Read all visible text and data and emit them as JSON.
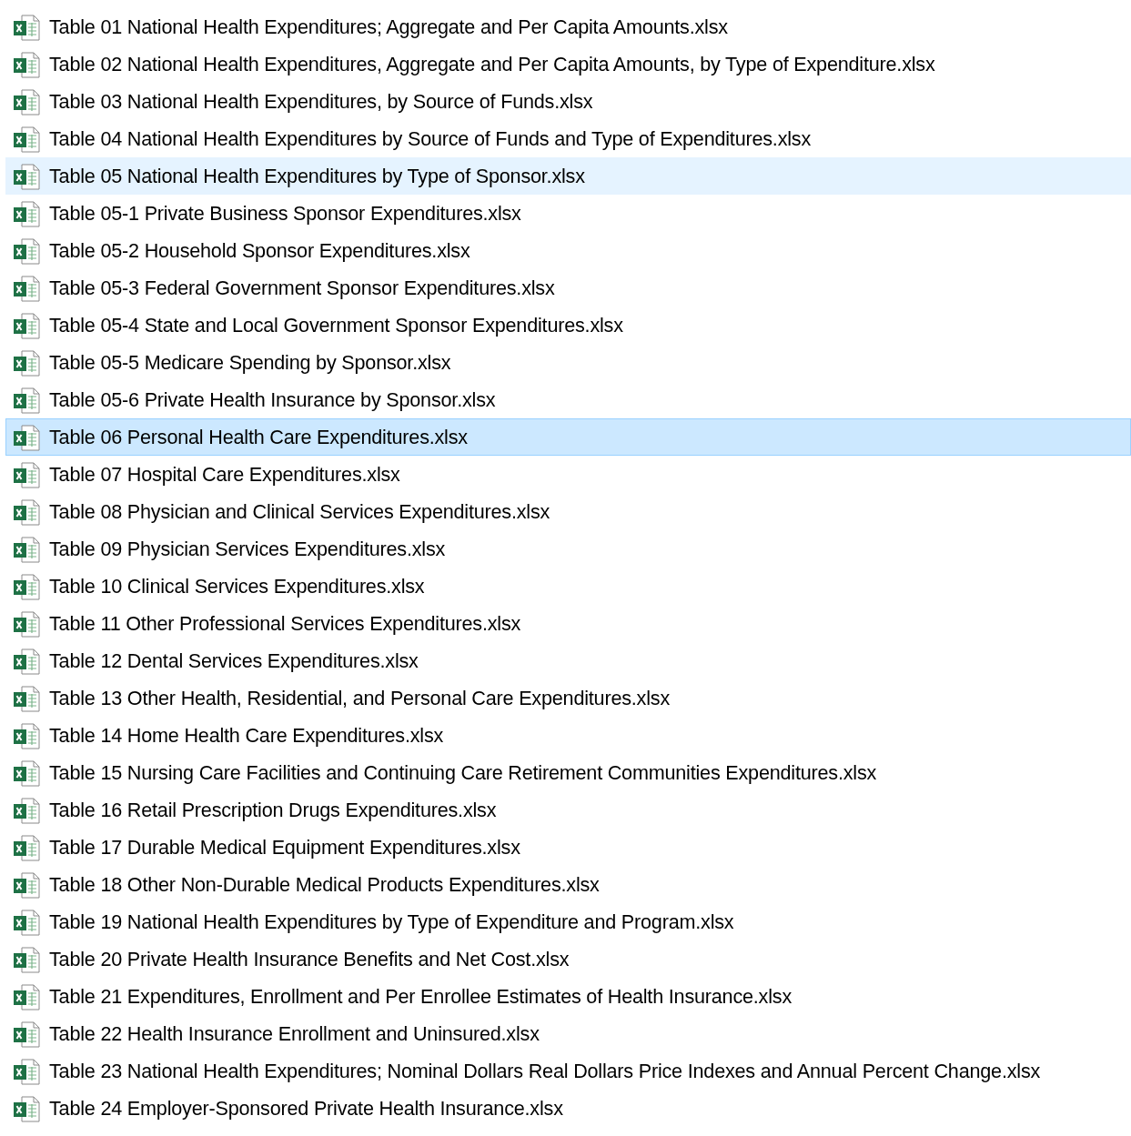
{
  "files": [
    {
      "name": "Table 01 National Health Expenditures; Aggregate and Per Capita Amounts.xlsx",
      "selected": false,
      "hovered": false
    },
    {
      "name": "Table 02 National Health Expenditures, Aggregate and Per Capita Amounts, by Type of Expenditure.xlsx",
      "selected": false,
      "hovered": false
    },
    {
      "name": "Table 03 National Health Expenditures, by Source of Funds.xlsx",
      "selected": false,
      "hovered": false
    },
    {
      "name": "Table 04 National Health Expenditures by Source of Funds and Type of Expenditures.xlsx",
      "selected": false,
      "hovered": false
    },
    {
      "name": "Table 05 National Health Expenditures by Type of Sponsor.xlsx",
      "selected": false,
      "hovered": true
    },
    {
      "name": "Table 05-1 Private Business Sponsor Expenditures.xlsx",
      "selected": false,
      "hovered": false
    },
    {
      "name": "Table 05-2 Household Sponsor Expenditures.xlsx",
      "selected": false,
      "hovered": false
    },
    {
      "name": "Table 05-3 Federal Government Sponsor Expenditures.xlsx",
      "selected": false,
      "hovered": false
    },
    {
      "name": "Table 05-4 State and Local Government Sponsor Expenditures.xlsx",
      "selected": false,
      "hovered": false
    },
    {
      "name": "Table 05-5 Medicare Spending by Sponsor.xlsx",
      "selected": false,
      "hovered": false
    },
    {
      "name": "Table 05-6 Private Health Insurance by Sponsor.xlsx",
      "selected": false,
      "hovered": false
    },
    {
      "name": "Table 06 Personal Health Care Expenditures.xlsx",
      "selected": true,
      "hovered": false
    },
    {
      "name": "Table 07 Hospital Care Expenditures.xlsx",
      "selected": false,
      "hovered": false
    },
    {
      "name": "Table 08 Physician and Clinical Services Expenditures.xlsx",
      "selected": false,
      "hovered": false
    },
    {
      "name": "Table 09 Physician Services Expenditures.xlsx",
      "selected": false,
      "hovered": false
    },
    {
      "name": "Table 10 Clinical Services Expenditures.xlsx",
      "selected": false,
      "hovered": false
    },
    {
      "name": "Table 11 Other Professional Services Expenditures.xlsx",
      "selected": false,
      "hovered": false
    },
    {
      "name": "Table 12 Dental Services Expenditures.xlsx",
      "selected": false,
      "hovered": false
    },
    {
      "name": "Table 13 Other Health, Residential, and Personal Care Expenditures.xlsx",
      "selected": false,
      "hovered": false
    },
    {
      "name": "Table 14 Home Health Care Expenditures.xlsx",
      "selected": false,
      "hovered": false
    },
    {
      "name": "Table 15 Nursing Care Facilities and Continuing Care Retirement Communities Expenditures.xlsx",
      "selected": false,
      "hovered": false
    },
    {
      "name": "Table 16 Retail Prescription Drugs Expenditures.xlsx",
      "selected": false,
      "hovered": false
    },
    {
      "name": "Table 17 Durable Medical Equipment Expenditures.xlsx",
      "selected": false,
      "hovered": false
    },
    {
      "name": "Table 18 Other Non-Durable Medical Products Expenditures.xlsx",
      "selected": false,
      "hovered": false
    },
    {
      "name": "Table 19 National Health Expenditures by Type of Expenditure and Program.xlsx",
      "selected": false,
      "hovered": false
    },
    {
      "name": "Table 20 Private Health Insurance Benefits and Net Cost.xlsx",
      "selected": false,
      "hovered": false
    },
    {
      "name": "Table 21 Expenditures, Enrollment and Per Enrollee Estimates of Health Insurance.xlsx",
      "selected": false,
      "hovered": false
    },
    {
      "name": "Table 22 Health Insurance Enrollment and Uninsured.xlsx",
      "selected": false,
      "hovered": false
    },
    {
      "name": "Table 23 National Health Expenditures; Nominal Dollars Real Dollars Price Indexes and Annual Percent Change.xlsx",
      "selected": false,
      "hovered": false
    },
    {
      "name": "Table 24 Employer-Sponsored Private Health Insurance.xlsx",
      "selected": false,
      "hovered": false
    }
  ]
}
